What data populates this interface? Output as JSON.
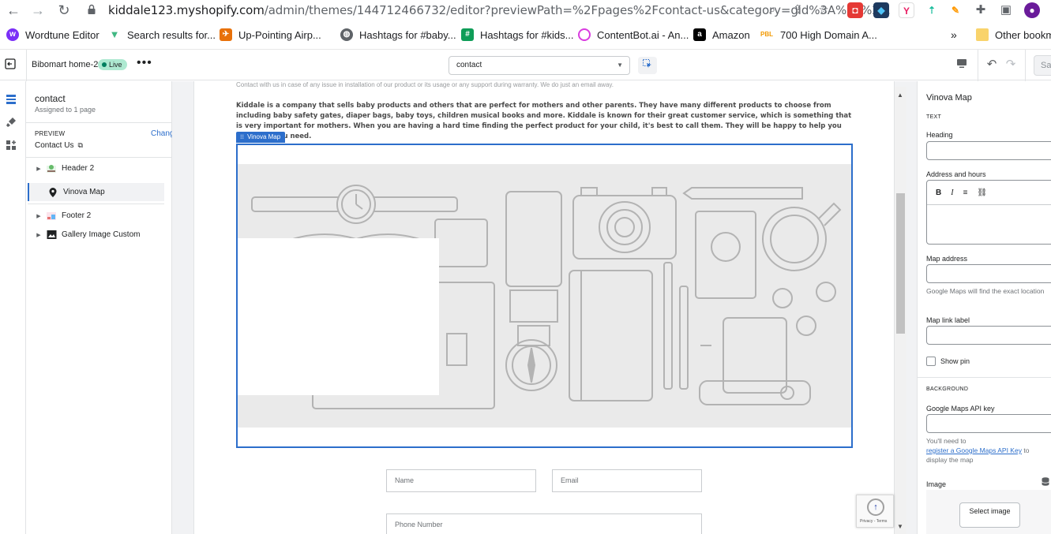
{
  "browser": {
    "url_host": "kiddale123.myshopify.com",
    "url_path": "/admin/themes/144712466732/editor?previewPath=%2Fpages%2Fcontact-us&category=gid%3A%2F%2..."
  },
  "bookmarks": [
    {
      "label": "Wordtune Editor",
      "icon": "wordtune-icon",
      "color": "#7b2ff7"
    },
    {
      "label": "Search results for...",
      "icon": "vuejs-icon",
      "color": "#41b883"
    },
    {
      "label": "Up-Pointing Airp...",
      "icon": "airplane-icon",
      "color": "#e8710a"
    },
    {
      "label": "Hashtags for #baby...",
      "icon": "globe-icon",
      "color": "#5f6368"
    },
    {
      "label": "Hashtags for #kids...",
      "icon": "hashtag-icon",
      "color": "#0f9d58"
    },
    {
      "label": "ContentBot.ai - An...",
      "icon": "contentbot-icon",
      "color": "#d93ce0"
    },
    {
      "label": "Amazon",
      "icon": "amazon-icon",
      "color": "#000000"
    },
    {
      "label": "700 High Domain A...",
      "icon": "pbl-icon",
      "color": "#f29900"
    }
  ],
  "bookmarks_more": "»",
  "other_bookmarks": "Other bookmarks",
  "topbar": {
    "theme_name": "Bibomart home-2",
    "live_label": "Live",
    "page_select": "contact",
    "save_label": "Save"
  },
  "sections_panel": {
    "template_title": "contact",
    "template_sub": "Assigned to 1 page",
    "preview_label": "PREVIEW",
    "change_label": "Change",
    "preview_page": "Contact Us",
    "items": [
      {
        "label": "Header 2",
        "icon": "header-icon"
      },
      {
        "label": "Vinova Map",
        "icon": "map-pin-icon"
      },
      {
        "label": "Footer 2",
        "icon": "footer-icon"
      },
      {
        "label": "Gallery Image Custom",
        "icon": "image-icon"
      }
    ]
  },
  "preview": {
    "clipped_line": "Contact with us in case of any issue in installation of our product or its usage or any support during warranty. We do just an email away.",
    "paragraph": "Kiddale is a company that sells baby products and others that are perfect for mothers and other parents. They have many different products to choose from including baby safety gates, diaper bags, baby toys, children musical books and more. Kiddale is known for their great customer service, which is something that is very important for mothers. When you are having a hard time finding the perfect product for your child, it's best to call them. They will be happy to help you find what you need.",
    "section_tag": "Vinova Map",
    "form": {
      "name_placeholder": "Name",
      "email_placeholder": "Email",
      "phone_placeholder": "Phone Number"
    },
    "recaptcha": "Privacy - Terms"
  },
  "settings": {
    "title": "Vinova Map",
    "text_group": "TEXT",
    "heading_label": "Heading",
    "address_label": "Address and hours",
    "rte_buttons": [
      "B",
      "I",
      "≡",
      "🔗"
    ],
    "map_address_label": "Map address",
    "map_address_help": "Google Maps will find the exact location",
    "map_link_label": "Map link label",
    "show_pin_label": "Show pin",
    "show_pin_checked": false,
    "background_group": "BACKGROUND",
    "api_key_label": "Google Maps API key",
    "api_help_prefix": "You'll need to",
    "api_help_link": "register a Google Maps API Key",
    "api_help_mid": "to",
    "api_help_suffix": "display the map",
    "image_label": "Image",
    "select_image_label": "Select image"
  },
  "colors": {
    "accent": "#2c6ecb",
    "live_badge": "#aee9d1"
  }
}
